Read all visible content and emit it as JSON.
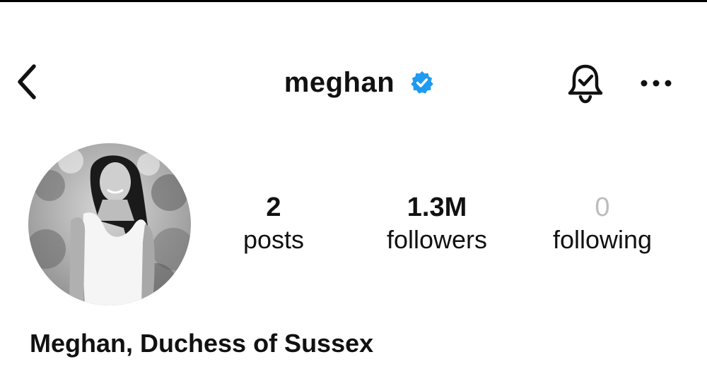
{
  "header": {
    "username": "meghan",
    "verified": true,
    "verified_color": "#1D9BF0"
  },
  "icons": {
    "back": "chevron-left-icon",
    "verified": "verified-badge-icon",
    "notifications": "bell-check-icon",
    "more": "more-horizontal-icon"
  },
  "profile": {
    "avatar_description": "black-and-white portrait photo",
    "stats": [
      {
        "value": "2",
        "label": "posts"
      },
      {
        "value": "1.3M",
        "label": "followers"
      },
      {
        "value": "0",
        "label": "following"
      }
    ],
    "full_name": "Meghan, Duchess of Sussex"
  }
}
